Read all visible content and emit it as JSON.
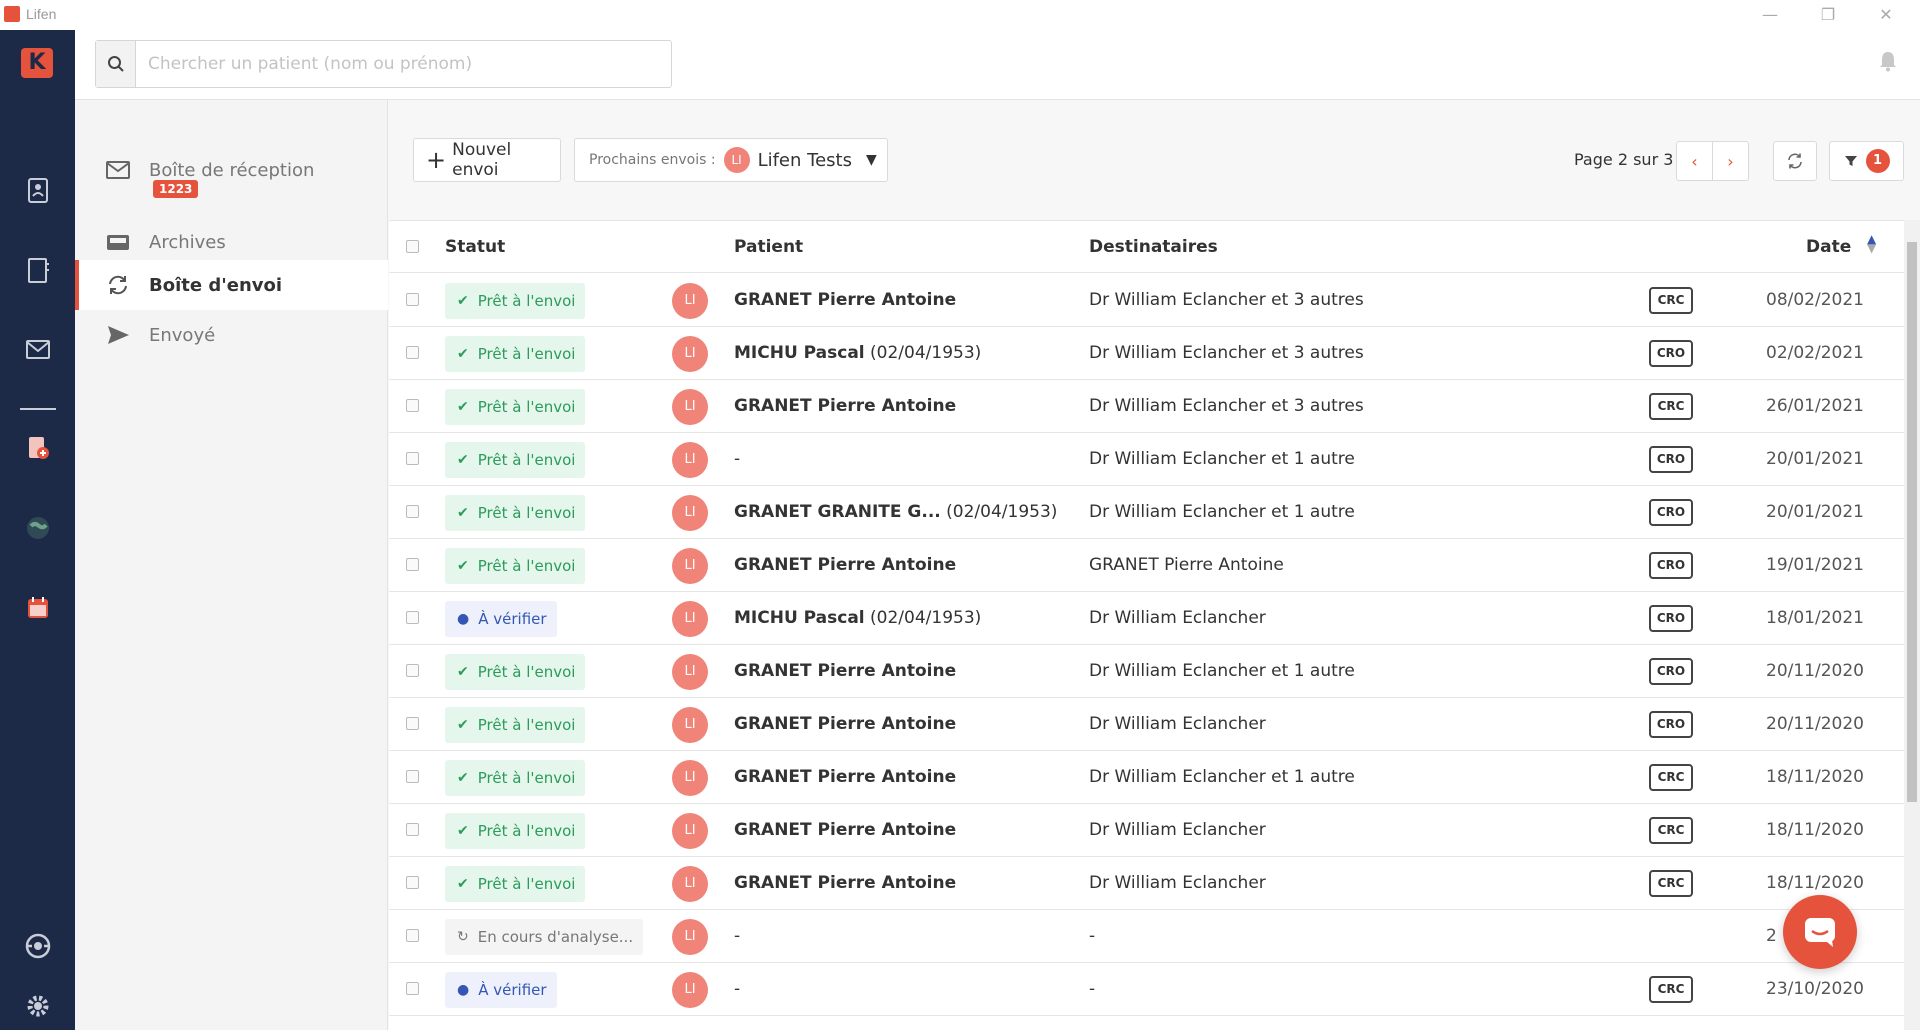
{
  "window": {
    "title": "Lifen",
    "minimize": "—",
    "restore": "❐",
    "close": "✕"
  },
  "rail": {
    "icons": [
      "logo-icon",
      "patient-file-icon",
      "contacts-book-icon",
      "mail-icon",
      "document-plus-icon",
      "globe-icon",
      "calendar-icon",
      "support-icon",
      "settings-icon"
    ]
  },
  "search": {
    "placeholder": "Chercher un patient (nom ou prénom)"
  },
  "folders": {
    "inbox": {
      "label": "Boîte de réception",
      "count": "1223"
    },
    "archives": {
      "label": "Archives"
    },
    "outbox": {
      "label": "Boîte d'envoi"
    },
    "sent": {
      "label": "Envoyé"
    }
  },
  "toolbar": {
    "new_send": "Nouvel envoi",
    "next_sends_label": "Prochains envois :",
    "next_sends_avatar": "LI",
    "next_sends_value": "Lifen Tests",
    "page_info": "Page 2 sur 3",
    "prev": "‹",
    "next": "›",
    "filter_count": "1"
  },
  "table": {
    "headers": {
      "status": "Statut",
      "patient": "Patient",
      "recipients": "Destinataires",
      "date": "Date"
    },
    "rows": [
      {
        "status": "Prêt à l'envoi",
        "status_kind": "ready",
        "avatar": "LI",
        "patient_name": "GRANET Pierre Antoine",
        "patient_extra": "",
        "recipients": "Dr William Eclancher et 3 autres",
        "doc_type": "CRC",
        "date": "08/02/2021"
      },
      {
        "status": "Prêt à l'envoi",
        "status_kind": "ready",
        "avatar": "LI",
        "patient_name": "MICHU Pascal",
        "patient_extra": "(02/04/1953)",
        "recipients": "Dr William Eclancher et 3 autres",
        "doc_type": "CRO",
        "date": "02/02/2021"
      },
      {
        "status": "Prêt à l'envoi",
        "status_kind": "ready",
        "avatar": "LI",
        "patient_name": "GRANET Pierre Antoine",
        "patient_extra": "",
        "recipients": "Dr William Eclancher et 3 autres",
        "doc_type": "CRC",
        "date": "26/01/2021"
      },
      {
        "status": "Prêt à l'envoi",
        "status_kind": "ready",
        "avatar": "LI",
        "patient_name": "",
        "patient_extra": "-",
        "recipients": "Dr William Eclancher et 1 autre",
        "doc_type": "CRO",
        "date": "20/01/2021"
      },
      {
        "status": "Prêt à l'envoi",
        "status_kind": "ready",
        "avatar": "LI",
        "patient_name": "GRANET GRANITE G...",
        "patient_extra": "(02/04/1953)",
        "recipients": "Dr William Eclancher et 1 autre",
        "doc_type": "CRO",
        "date": "20/01/2021"
      },
      {
        "status": "Prêt à l'envoi",
        "status_kind": "ready",
        "avatar": "LI",
        "patient_name": "GRANET Pierre Antoine",
        "patient_extra": "",
        "recipients": "GRANET Pierre Antoine",
        "doc_type": "CRO",
        "date": "19/01/2021"
      },
      {
        "status": "À vérifier",
        "status_kind": "verify",
        "avatar": "LI",
        "patient_name": "MICHU Pascal",
        "patient_extra": "(02/04/1953)",
        "recipients": "Dr William Eclancher",
        "doc_type": "CRO",
        "date": "18/01/2021"
      },
      {
        "status": "Prêt à l'envoi",
        "status_kind": "ready",
        "avatar": "LI",
        "patient_name": "GRANET Pierre Antoine",
        "patient_extra": "",
        "recipients": "Dr William Eclancher et 1 autre",
        "doc_type": "CRO",
        "date": "20/11/2020"
      },
      {
        "status": "Prêt à l'envoi",
        "status_kind": "ready",
        "avatar": "LI",
        "patient_name": "GRANET Pierre Antoine",
        "patient_extra": "",
        "recipients": "Dr William Eclancher",
        "doc_type": "CRO",
        "date": "20/11/2020"
      },
      {
        "status": "Prêt à l'envoi",
        "status_kind": "ready",
        "avatar": "LI",
        "patient_name": "GRANET Pierre Antoine",
        "patient_extra": "",
        "recipients": "Dr William Eclancher et 1 autre",
        "doc_type": "CRC",
        "date": "18/11/2020"
      },
      {
        "status": "Prêt à l'envoi",
        "status_kind": "ready",
        "avatar": "LI",
        "patient_name": "GRANET Pierre Antoine",
        "patient_extra": "",
        "recipients": "Dr William Eclancher",
        "doc_type": "CRC",
        "date": "18/11/2020"
      },
      {
        "status": "Prêt à l'envoi",
        "status_kind": "ready",
        "avatar": "LI",
        "patient_name": "GRANET Pierre Antoine",
        "patient_extra": "",
        "recipients": "Dr William Eclancher",
        "doc_type": "CRC",
        "date": "18/11/2020"
      },
      {
        "status": "En cours d'analyse...",
        "status_kind": "analysis",
        "avatar": "LI",
        "patient_name": "",
        "patient_extra": "-",
        "recipients": "-",
        "doc_type": "",
        "date": "2"
      },
      {
        "status": "À vérifier",
        "status_kind": "verify",
        "avatar": "LI",
        "patient_name": "",
        "patient_extra": "-",
        "recipients": "-",
        "doc_type": "CRC",
        "date": "23/10/2020"
      }
    ]
  },
  "colors": {
    "brand": "#e5533d",
    "rail": "#1c2a47",
    "ready": "#2c9c5a",
    "verify": "#3457b5"
  }
}
